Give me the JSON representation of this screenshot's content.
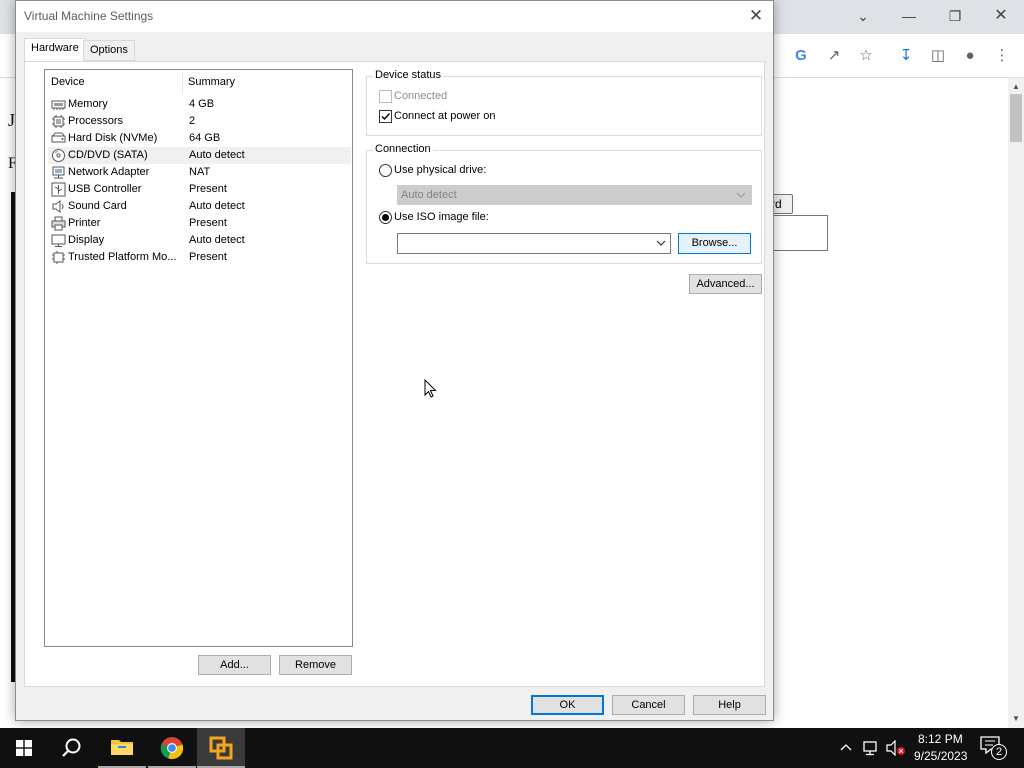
{
  "browser": {
    "page_letters": [
      "J",
      "F"
    ],
    "page_button_label": "rd"
  },
  "dialog": {
    "title": "Virtual Machine Settings",
    "tabs": [
      {
        "label": "Hardware",
        "active": true
      },
      {
        "label": "Options",
        "active": false
      }
    ],
    "device_list": {
      "columns": {
        "device": "Device",
        "summary": "Summary"
      },
      "rows": [
        {
          "name": "Memory",
          "summary": "4 GB",
          "icon": "memory-icon"
        },
        {
          "name": "Processors",
          "summary": "2",
          "icon": "processor-icon"
        },
        {
          "name": "Hard Disk (NVMe)",
          "summary": "64 GB",
          "icon": "hard-disk-icon"
        },
        {
          "name": "CD/DVD (SATA)",
          "summary": "Auto detect",
          "icon": "cd-dvd-icon",
          "selected": true
        },
        {
          "name": "Network Adapter",
          "summary": "NAT",
          "icon": "network-adapter-icon"
        },
        {
          "name": "USB Controller",
          "summary": "Present",
          "icon": "usb-icon"
        },
        {
          "name": "Sound Card",
          "summary": "Auto detect",
          "icon": "sound-card-icon"
        },
        {
          "name": "Printer",
          "summary": "Present",
          "icon": "printer-icon"
        },
        {
          "name": "Display",
          "summary": "Auto detect",
          "icon": "display-icon"
        },
        {
          "name": "Trusted Platform Mo...",
          "summary": "Present",
          "icon": "tpm-icon"
        }
      ]
    },
    "add_button": "Add...",
    "remove_button": "Remove",
    "device_status": {
      "label": "Device status",
      "connected": {
        "label": "Connected",
        "checked": false,
        "disabled": true
      },
      "connect_at_power_on": {
        "label": "Connect at power on",
        "checked": true
      }
    },
    "connection": {
      "label": "Connection",
      "use_physical_drive": "Use physical drive:",
      "physical_drive_value": "Auto detect",
      "use_iso": "Use ISO image file:",
      "iso_value": "",
      "browse_button": "Browse...",
      "selected": "iso"
    },
    "advanced_button": "Advanced...",
    "ok_button": "OK",
    "cancel_button": "Cancel",
    "help_button": "Help"
  },
  "taskbar": {
    "time": "8:12 PM",
    "date": "9/25/2023",
    "notification_count": "2",
    "pinned": [
      "start-icon",
      "search-icon",
      "file-explorer-icon",
      "chrome-icon",
      "vmware-icon"
    ]
  },
  "colors": {
    "accent": "#0078d7",
    "dialog_bg": "#f0f0f0",
    "taskbar_bg": "#101010"
  }
}
